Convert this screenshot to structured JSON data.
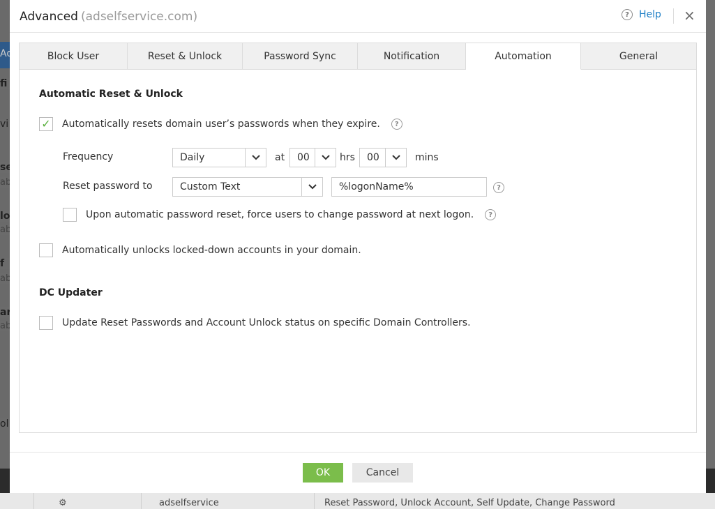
{
  "background": {
    "left_snippets": [
      {
        "text": "Ad"
      },
      {
        "text": "fi"
      },
      {
        "text": "vi"
      },
      {
        "text": "se"
      },
      {
        "text": "ab"
      },
      {
        "text": "lo"
      },
      {
        "text": "ab"
      },
      {
        "text": "f"
      },
      {
        "text": "ab"
      },
      {
        "text": "ar"
      },
      {
        "text": "ab"
      },
      {
        "text": "ol"
      }
    ],
    "bottom_text": "adselfservice",
    "bottom_text2": "Reset Password, Unlock Account, Self Update, Change Password"
  },
  "dialog": {
    "title": "Advanced",
    "subtitle": "(adselfservice.com)",
    "help_label": "Help",
    "close_label": "×"
  },
  "tabs": [
    {
      "label": "Block User",
      "active": false
    },
    {
      "label": "Reset & Unlock",
      "active": false
    },
    {
      "label": "Password Sync",
      "active": false
    },
    {
      "label": "Notification",
      "active": false
    },
    {
      "label": "Automation",
      "active": true
    },
    {
      "label": "General",
      "active": false
    }
  ],
  "automation": {
    "section1_title": "Automatic Reset & Unlock",
    "auto_reset_label": "Automatically resets domain user’s passwords when they expire.",
    "auto_reset_checked": true,
    "frequency_label": "Frequency",
    "frequency_value": "Daily",
    "at_label": "at",
    "hours_value": "00",
    "hrs_label": "hrs",
    "minutes_value": "00",
    "mins_label": "mins",
    "reset_to_label": "Reset password to",
    "reset_to_value": "Custom Text",
    "custom_text_value": "%logonName%",
    "force_change_label": "Upon automatic password reset, force users to change password at next logon.",
    "force_change_checked": false,
    "auto_unlock_label": "Automatically unlocks locked-down accounts in your domain.",
    "auto_unlock_checked": false,
    "section2_title": "DC Updater",
    "dc_update_label": "Update Reset Passwords and Account Unlock status on specific Domain Controllers.",
    "dc_update_checked": false
  },
  "footer": {
    "ok_label": "OK",
    "cancel_label": "Cancel"
  },
  "colors": {
    "accent_green": "#7bbd4b",
    "link_blue": "#1e7fc6",
    "check_green": "#5ab03e"
  }
}
